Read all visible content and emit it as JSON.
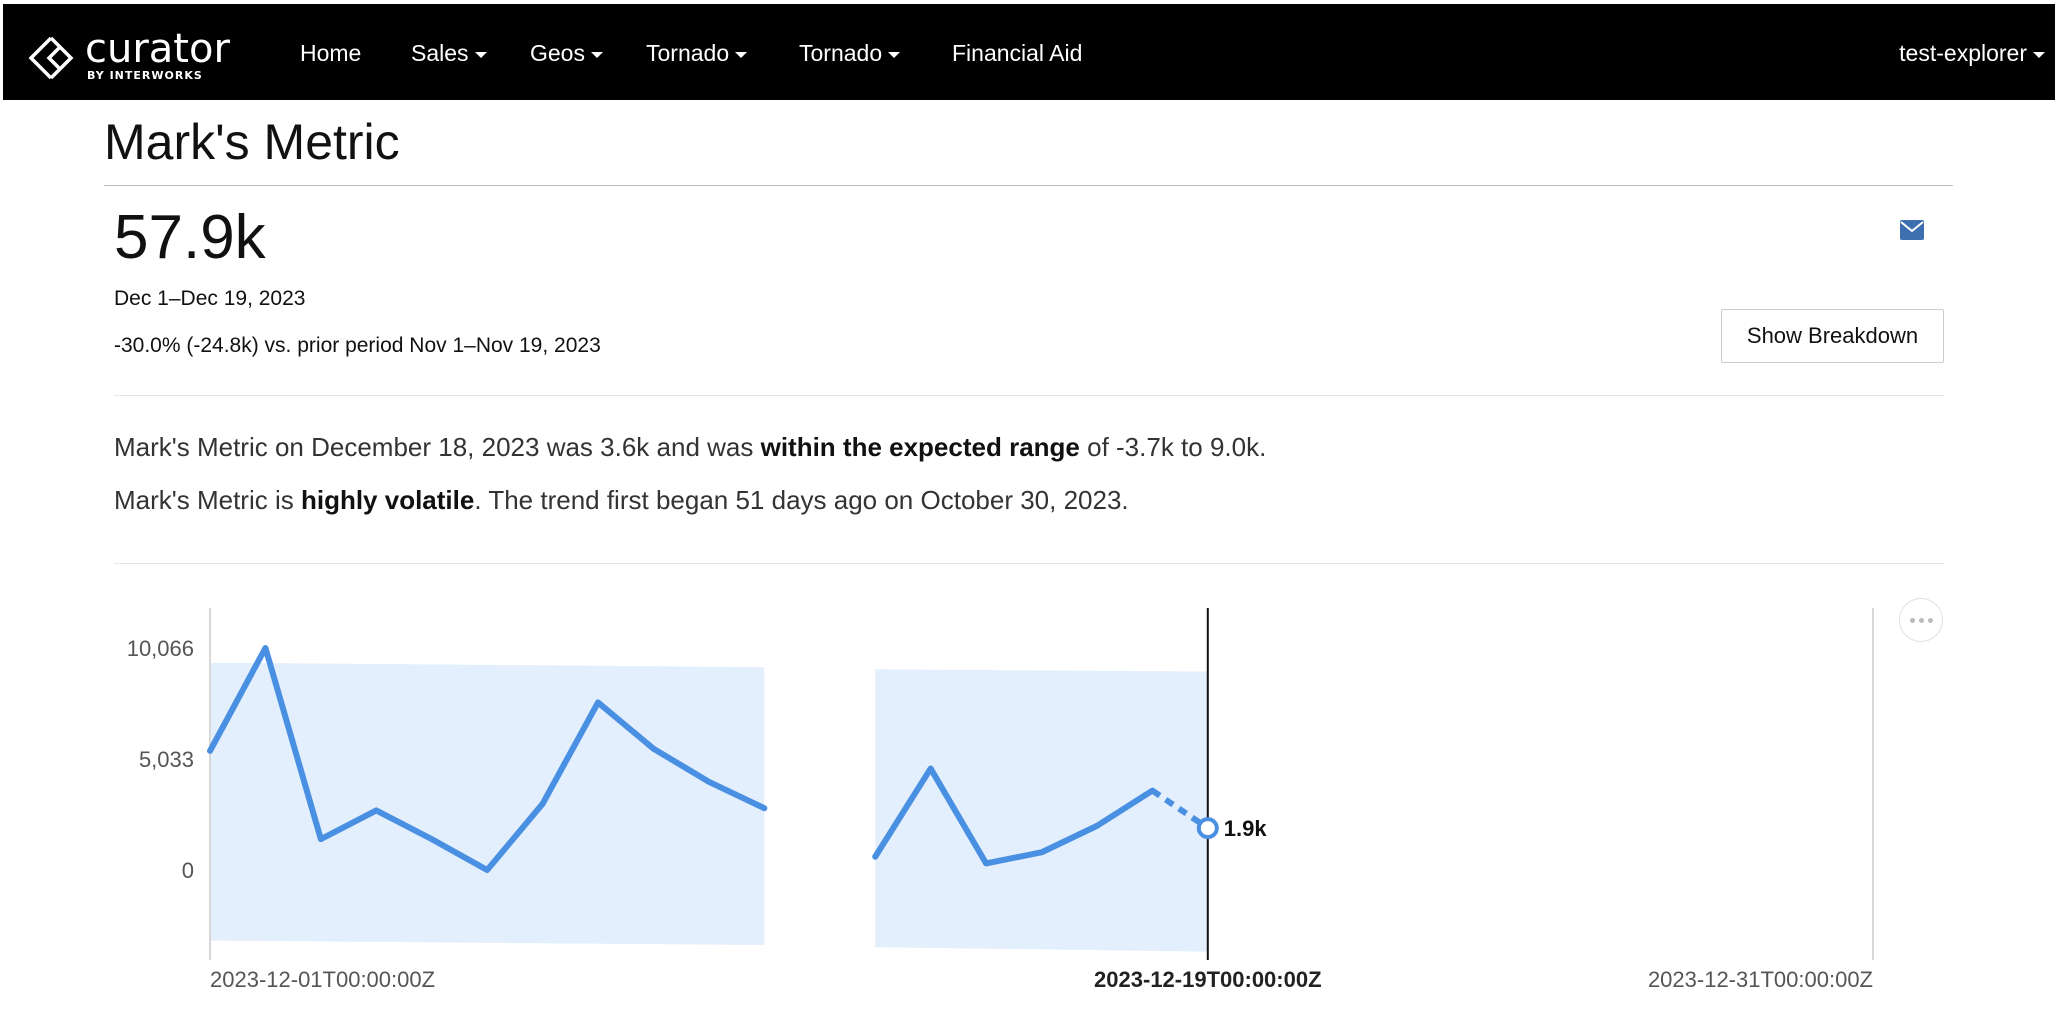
{
  "nav": {
    "brand": "curator",
    "brand_sub": "BY INTERWORKS",
    "items": [
      {
        "label": "Home",
        "dropdown": false
      },
      {
        "label": "Sales",
        "dropdown": true
      },
      {
        "label": "Geos",
        "dropdown": true
      },
      {
        "label": "Tornado",
        "dropdown": true
      },
      {
        "label": "Tornado",
        "dropdown": true
      },
      {
        "label": "Financial Aid",
        "dropdown": false
      }
    ],
    "user": "test-explorer"
  },
  "metric": {
    "title": "Mark's Metric",
    "value": "57.9k",
    "period": "Dec 1–Dec 19, 2023",
    "comparison": "-30.0% (-24.8k) vs. prior period Nov 1–Nov 19, 2023",
    "breakdown_label": "Show Breakdown"
  },
  "insights": {
    "line1_pre": "Mark's Metric on December 18, 2023 was 3.6k and was ",
    "line1_bold": "within the expected range",
    "line1_post": " of -3.7k to 9.0k.",
    "line2_pre": "Mark's Metric is ",
    "line2_bold": "highly volatile",
    "line2_post": ". The trend first began 51 days ago on October 30, 2023."
  },
  "icons": {
    "email": "envelope-icon",
    "more": "ellipsis-icon",
    "logo": "curator-logo-icon"
  },
  "colors": {
    "accent": "#3e6fb0",
    "line": "#4a90e2",
    "band": "#e3effc"
  },
  "chart_data": {
    "type": "line",
    "title": "",
    "xlabel": "",
    "ylabel": "",
    "y_ticks": [
      "10,066",
      "5,033",
      "0"
    ],
    "x_ticks": [
      "2023-12-01T00:00:00Z",
      "2023-12-19T00:00:00Z",
      "2023-12-31T00:00:00Z"
    ],
    "x_domain_days": [
      1,
      31
    ],
    "ylim": [
      -3400,
      10066
    ],
    "current_marker_day": 19,
    "current_label": "1.9k",
    "series": [
      {
        "segment": 1,
        "points": [
          {
            "day": 1,
            "value": 5400
          },
          {
            "day": 2,
            "value": 10066
          },
          {
            "day": 3,
            "value": 1400
          },
          {
            "day": 4,
            "value": 2700
          },
          {
            "day": 5,
            "value": 1400
          },
          {
            "day": 6,
            "value": 0
          },
          {
            "day": 7,
            "value": 3000
          },
          {
            "day": 8,
            "value": 7600
          },
          {
            "day": 9,
            "value": 5500
          },
          {
            "day": 10,
            "value": 4000
          },
          {
            "day": 11,
            "value": 2800
          }
        ],
        "band": [
          {
            "day": 1,
            "low": -3200,
            "high": 9400
          },
          {
            "day": 11,
            "low": -3400,
            "high": 9200
          }
        ]
      },
      {
        "segment": 2,
        "points": [
          {
            "day": 13,
            "value": 600
          },
          {
            "day": 14,
            "value": 4600
          },
          {
            "day": 15,
            "value": 300
          },
          {
            "day": 16,
            "value": 800
          },
          {
            "day": 17,
            "value": 2000
          },
          {
            "day": 18,
            "value": 3600
          }
        ],
        "projected": [
          {
            "day": 18,
            "value": 3600
          },
          {
            "day": 19,
            "value": 1900
          }
        ],
        "band": [
          {
            "day": 13,
            "low": -3500,
            "high": 9100
          },
          {
            "day": 19,
            "low": -3700,
            "high": 9000
          }
        ]
      }
    ]
  }
}
